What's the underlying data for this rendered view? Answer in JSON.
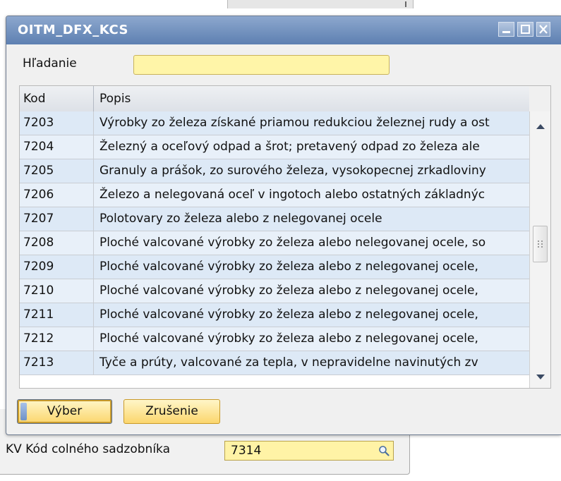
{
  "background_form": {
    "field_label": "KV Kód colného sadzobníka",
    "field_value": "7314",
    "field_icon": "search-icon"
  },
  "dialog": {
    "title": "OITM_DFX_KCS",
    "window_buttons": [
      "minimize-icon",
      "maximize-icon",
      "close-icon"
    ],
    "search": {
      "label": "Hľadanie",
      "value": ""
    },
    "table": {
      "columns": [
        "Kod",
        "Popis"
      ],
      "rows": [
        {
          "kod": "7203",
          "popis": "Výrobky zo železa získané priamou redukciou železnej rudy a ost"
        },
        {
          "kod": "7204",
          "popis": "Železný a oceľový odpad a šrot; pretavený odpad zo železa ale"
        },
        {
          "kod": "7205",
          "popis": "Granuly a prášok, zo surového železa, vysokopecnej zrkadloviny"
        },
        {
          "kod": "7206",
          "popis": "Železo a nelegovaná oceľ v ingotoch alebo ostatných základnýc"
        },
        {
          "kod": "7207",
          "popis": "Polotovary zo železa alebo z nelegovanej ocele"
        },
        {
          "kod": "7208",
          "popis": "Ploché valcované výrobky zo železa alebo nelegovanej ocele, so"
        },
        {
          "kod": "7209",
          "popis": "Ploché valcované výrobky zo železa alebo z nelegovanej ocele,"
        },
        {
          "kod": "7210",
          "popis": "Ploché valcované výrobky zo železa alebo z nelegovanej ocele,"
        },
        {
          "kod": "7211",
          "popis": "Ploché valcované výrobky zo železa alebo z nelegovanej ocele,"
        },
        {
          "kod": "7212",
          "popis": "Ploché valcované výrobky zo železa alebo z nelegovanej ocele,"
        },
        {
          "kod": "7213",
          "popis": "Tyče a prúty, valcované za tepla, v nepravidelne navinutých zv"
        }
      ]
    },
    "buttons": {
      "select": "Výber",
      "cancel": "Zrušenie"
    }
  },
  "colors": {
    "titlebar": "#5d80b1",
    "input_yellow": "#fff5a8",
    "row_blue": "#dde9f6",
    "button_orange": "#fbd66d"
  }
}
